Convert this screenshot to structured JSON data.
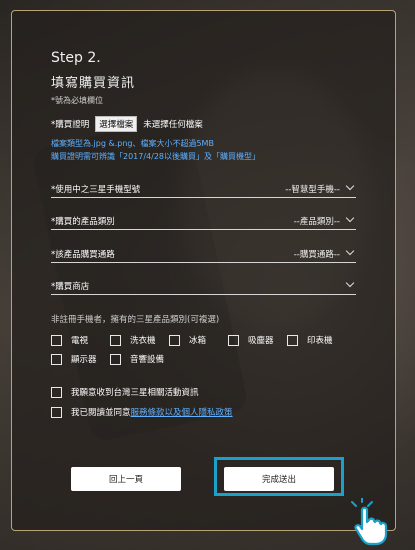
{
  "step": "Step 2.",
  "heading": "填寫購買資訊",
  "required_note": "*號為必填欄位",
  "upload": {
    "label": "*購買證明",
    "button": "選擇檔案",
    "status": "未選擇任何檔案",
    "hint1": "檔案類型為.jpg &.png、檔案大小不超過5MB",
    "hint2": "購買證明需可辨識「2017/4/28以後購買」及「購買機型」"
  },
  "fields": [
    {
      "label": "*使用中之三星手機型號",
      "value": "--智慧型手機--"
    },
    {
      "label": "*購買的產品類別",
      "value": "--產品類別--"
    },
    {
      "label": "*該產品購買通路",
      "value": "--購買通路--"
    },
    {
      "label": "*購買商店",
      "value": ""
    }
  ],
  "category_note": "非註冊手機者，擁有的三星產品類別(可複選)",
  "categories_row1": [
    "電視",
    "洗衣機",
    "冰箱",
    "吸塵器",
    "印表機"
  ],
  "categories_row2": [
    "顯示器",
    "音響設備"
  ],
  "consent": {
    "info_label": "我願意收到台灣三星相關活動資訊",
    "terms_prefix": "我已閱讀並同意",
    "terms_link": "服務條款以及個人隱私政策"
  },
  "buttons": {
    "prev": "回上一頁",
    "submit": "完成送出"
  },
  "colors": {
    "accent_frame": "#1aa0c9",
    "link": "#5fb0ff",
    "panel_border": "#b9a376"
  }
}
